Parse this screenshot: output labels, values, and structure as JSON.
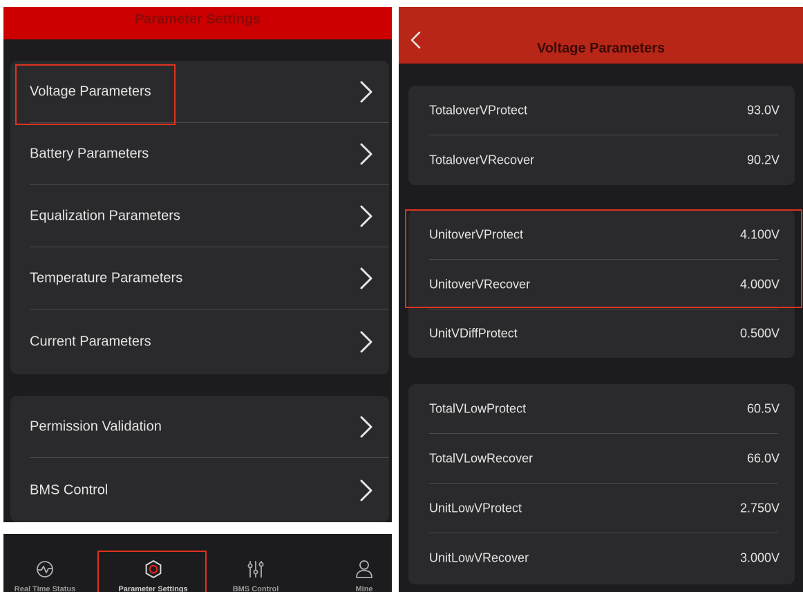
{
  "parameter_settings": {
    "title": "Parameter Settings",
    "groups": [
      [
        "Voltage Parameters",
        "Battery Parameters",
        "Equalization Parameters",
        "Temperature Parameters",
        "Current Parameters"
      ],
      [
        "Permission Validation",
        "BMS Control"
      ]
    ]
  },
  "tabbar": {
    "tabs": [
      {
        "label": "Real Time Status",
        "icon": "pulse-icon"
      },
      {
        "label": "Parameter Settings",
        "icon": "hexagon-settings-icon",
        "active": true
      },
      {
        "label": "BMS Control",
        "icon": "sliders-icon"
      },
      {
        "label": "Mine",
        "icon": "person-icon"
      }
    ]
  },
  "voltage_parameters": {
    "title": "Voltage Parameters",
    "back_icon": "chevron-left-icon",
    "groups": [
      [
        {
          "name": "TotaloverVProtect",
          "value": "93.0V"
        },
        {
          "name": "TotaloverVRecover",
          "value": "90.2V"
        }
      ],
      [
        {
          "name": "UnitoverVProtect",
          "value": "4.100V"
        },
        {
          "name": "UnitoverVRecover",
          "value": "4.000V"
        },
        {
          "name": "UnitVDiffProtect",
          "value": "0.500V"
        }
      ],
      [
        {
          "name": "TotalVLowProtect",
          "value": "60.5V"
        },
        {
          "name": "TotalVLowRecover",
          "value": "66.0V"
        },
        {
          "name": "UnitLowVProtect",
          "value": "2.750V"
        },
        {
          "name": "UnitLowVRecover",
          "value": "3.000V"
        }
      ]
    ]
  },
  "colors": {
    "header_red": "#cc0000",
    "header_red_dark": "#b82617",
    "annotation_red": "#e0321e",
    "background": "#1c1c1e",
    "card": "#2a2a2c"
  }
}
